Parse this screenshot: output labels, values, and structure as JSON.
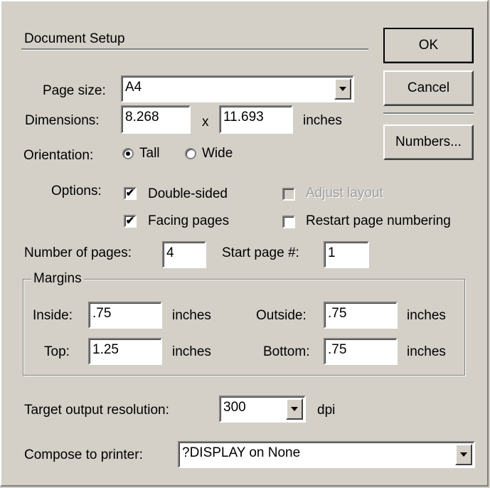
{
  "dialog": {
    "title": "Document Setup",
    "buttons": {
      "ok": "OK",
      "cancel": "Cancel",
      "numbers": "Numbers..."
    }
  },
  "page_size": {
    "label": "Page size:",
    "value": "A4"
  },
  "dimensions": {
    "label": "Dimensions:",
    "width": "8.268",
    "times": "x",
    "height": "11.693",
    "unit": "inches"
  },
  "orientation": {
    "label": "Orientation:",
    "tall": {
      "label": "Tall",
      "selected": true
    },
    "wide": {
      "label": "Wide",
      "selected": false
    }
  },
  "options": {
    "label": "Options:",
    "double_sided": {
      "label": "Double-sided",
      "checked": true
    },
    "facing_pages": {
      "label": "Facing pages",
      "checked": true
    },
    "adjust_layout": {
      "label": "Adjust layout",
      "checked": false,
      "enabled": false
    },
    "restart_numbering": {
      "label": "Restart page numbering",
      "checked": false
    }
  },
  "pages": {
    "count_label": "Number of pages:",
    "count": "4",
    "start_label": "Start page #:",
    "start": "1"
  },
  "margins": {
    "legend": "Margins",
    "inside": {
      "label": "Inside:",
      "value": ".75",
      "unit": "inches"
    },
    "outside": {
      "label": "Outside:",
      "value": ".75",
      "unit": "inches"
    },
    "top": {
      "label": "Top:",
      "value": "1.25",
      "unit": "inches"
    },
    "bottom": {
      "label": "Bottom:",
      "value": ".75",
      "unit": "inches"
    }
  },
  "resolution": {
    "label": "Target output resolution:",
    "value": "300",
    "unit": "dpi"
  },
  "printer": {
    "label": "Compose to printer:",
    "value": "?DISPLAY on None"
  },
  "icons": {
    "checkmark": "✔",
    "dropdown": "dropdown-arrow-icon"
  }
}
